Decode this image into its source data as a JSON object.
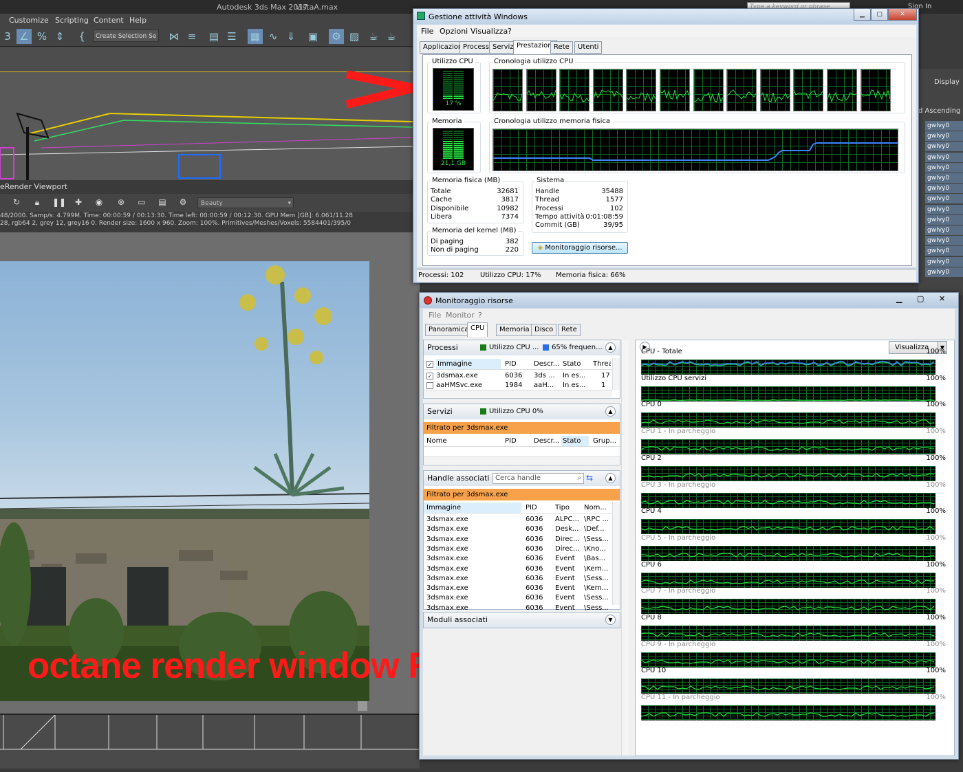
{
  "max": {
    "title": "Autodesk 3ds Max 2017",
    "file": "vistaA.max",
    "search_placeholder": "Type a keyword or phrase",
    "sign_in": "Sign In",
    "menu": [
      "Customize",
      "Scripting",
      "Content",
      "Help"
    ],
    "selection_set": "Create Selection Se",
    "right_panel": {
      "display": "Display",
      "sort": "d Ascending",
      "items": [
        "gwIvy0",
        "gwIvy0",
        "gwIvy0",
        "gwIvy0",
        "gwIvy0",
        "gwIvy0",
        "gwIvy0",
        "gwIvy0",
        "gwIvy0",
        "gwIvy0",
        "gwIvy0",
        "gwIvy0",
        "gwIvy0",
        "gwIvy0",
        "gwIvy0"
      ]
    }
  },
  "octane": {
    "viewport_title": "eRender Viewport",
    "pass": "Beauty",
    "status_line1": "48/2000.   Samp/s: 4.799M.   Time: 00:00:59 / 00:13:30.   Time left: 00:00:59 / 00:12:30.   GPU Mem [GB]: 6.061/11.28",
    "status_line2": "28, rgb64 2, grey 12, grey16 0.   Render size: 1600 x 960.   Zoom: 100%.   Primitives/Meshes/Voxels: 5584401/395/0"
  },
  "annotation": "octane render window RUN",
  "task_manager": {
    "title": "Gestione attività Windows",
    "menu": [
      "File",
      "Opzioni",
      "Visualizza",
      "?"
    ],
    "tabs": [
      "Applicazioni",
      "Processi",
      "Servizi",
      "Prestazioni",
      "Rete",
      "Utenti"
    ],
    "active_tab": "Prestazioni",
    "cpu_usage_label": "Utilizzo CPU",
    "cpu_usage_value": "17 %",
    "cpu_usage_percent": 17,
    "cpu_history_label": "Cronologia utilizzo CPU",
    "memory_label": "Memoria",
    "memory_value": "21,1 GB",
    "memory_percent": 66,
    "memory_history_label": "Cronologia utilizzo memoria fisica",
    "physical_memory": {
      "title": "Memoria fisica (MB)",
      "rows": [
        {
          "k": "Totale",
          "v": "32681"
        },
        {
          "k": "Cache",
          "v": "3817"
        },
        {
          "k": "Disponibile",
          "v": "10982"
        },
        {
          "k": "Libera",
          "v": "7374"
        }
      ]
    },
    "system": {
      "title": "Sistema",
      "rows": [
        {
          "k": "Handle",
          "v": "35488"
        },
        {
          "k": "Thread",
          "v": "1577"
        },
        {
          "k": "Processi",
          "v": "102"
        },
        {
          "k": "Tempo attività",
          "v": "0:01:08:59"
        },
        {
          "k": "Commit (GB)",
          "v": "39/95"
        }
      ]
    },
    "kernel_memory": {
      "title": "Memoria del kernel (MB)",
      "rows": [
        {
          "k": "Di paging",
          "v": "382"
        },
        {
          "k": "Non di paging",
          "v": "220"
        }
      ]
    },
    "resource_monitor_button": "Monitoraggio risorse...",
    "status": {
      "processes": "Processi: 102",
      "cpu": "Utilizzo CPU: 17%",
      "memory": "Memoria fisica: 66%"
    }
  },
  "resource_monitor": {
    "title": "Monitoraggio risorse",
    "menu": [
      "File",
      "Monitor",
      "?"
    ],
    "tabs": [
      "Panoramica",
      "CPU",
      "Memoria",
      "Disco",
      "Rete"
    ],
    "active_tab": "CPU",
    "processes": {
      "title": "Processi",
      "cpu_badge": "Utilizzo CPU ...",
      "freq_badge": "65% frequen...",
      "columns": [
        "Immagine",
        "PID",
        "Descr...",
        "Stato",
        "Threa"
      ],
      "rows": [
        {
          "checked": true,
          "cells": [
            "3dsmax.exe",
            "6036",
            "3ds ...",
            "In es...",
            "17"
          ]
        },
        {
          "checked": false,
          "cells": [
            "aaHMSvc.exe",
            "1984",
            "aaH...",
            "In es...",
            "1"
          ]
        }
      ]
    },
    "services": {
      "title": "Servizi",
      "cpu_badge": "Utilizzo CPU 0%",
      "filter": "Filtrato per 3dsmax.exe",
      "columns": [
        "Nome",
        "PID",
        "Descr...",
        "Stato",
        "Grup..."
      ]
    },
    "handles": {
      "title": "Handle associati",
      "search_placeholder": "Cerca handle",
      "filter": "Filtrato per 3dsmax.exe",
      "columns": [
        "Immagine",
        "PID",
        "Tipo",
        "Nom..."
      ],
      "rows": [
        [
          "3dsmax.exe",
          "6036",
          "ALPC...",
          "\\RPC ..."
        ],
        [
          "3dsmax.exe",
          "6036",
          "Desk...",
          "\\Def..."
        ],
        [
          "3dsmax.exe",
          "6036",
          "Direc...",
          "\\Sess..."
        ],
        [
          "3dsmax.exe",
          "6036",
          "Direc...",
          "\\Kno..."
        ],
        [
          "3dsmax.exe",
          "6036",
          "Event",
          "\\Bas..."
        ],
        [
          "3dsmax.exe",
          "6036",
          "Event",
          "\\Kern..."
        ],
        [
          "3dsmax.exe",
          "6036",
          "Event",
          "\\Sess..."
        ],
        [
          "3dsmax.exe",
          "6036",
          "Event",
          "\\Kern..."
        ],
        [
          "3dsmax.exe",
          "6036",
          "Event",
          "\\Sess..."
        ],
        [
          "3dsmax.exe",
          "6036",
          "Event",
          "\\Sess..."
        ]
      ]
    },
    "modules": {
      "title": "Moduli associati"
    },
    "view_button": "Visualizza",
    "graphs": [
      {
        "label": "CPU - Totale",
        "pct": "100%",
        "dim": false
      },
      {
        "label": "Utilizzo CPU servizi",
        "pct": "100%",
        "dim": false
      },
      {
        "label": "CPU 0",
        "pct": "100%",
        "dim": false
      },
      {
        "label": "CPU 1 - In parcheggio",
        "pct": "100%",
        "dim": true
      },
      {
        "label": "CPU 2",
        "pct": "100%",
        "dim": false
      },
      {
        "label": "CPU 3 - In parcheggio",
        "pct": "100%",
        "dim": true
      },
      {
        "label": "CPU 4",
        "pct": "100%",
        "dim": false
      },
      {
        "label": "CPU 5 - In parcheggio",
        "pct": "100%",
        "dim": true
      },
      {
        "label": "CPU 6",
        "pct": "100%",
        "dim": false
      },
      {
        "label": "CPU 7 - In parcheggio",
        "pct": "100%",
        "dim": true
      },
      {
        "label": "CPU 8",
        "pct": "100%",
        "dim": false
      },
      {
        "label": "CPU 9 - In parcheggio",
        "pct": "100%",
        "dim": true
      },
      {
        "label": "CPU 10",
        "pct": "100%",
        "dim": false
      },
      {
        "label": "CPU 11 - In parcheggio",
        "pct": "100%",
        "dim": true
      }
    ]
  },
  "colors": {
    "graph_green": "#22e03c",
    "graph_blue": "#3a6cff",
    "filter_orange": "#f7a24a",
    "annotation_red": "#ff1a1a"
  }
}
